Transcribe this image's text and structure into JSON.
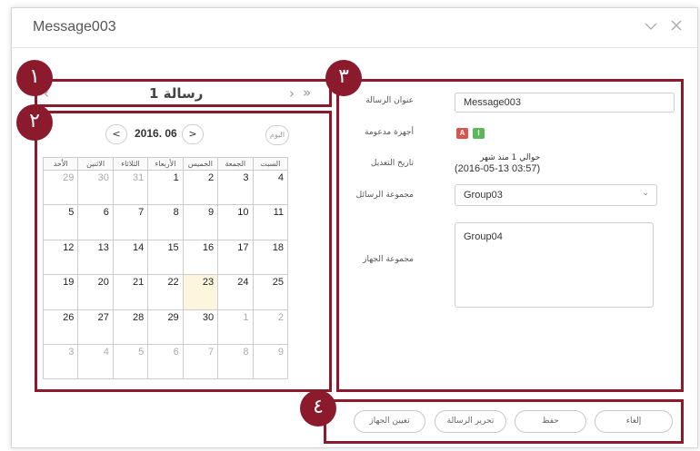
{
  "dialog": {
    "title": "Message003",
    "collapse_icon": "chevron-down-icon",
    "close_icon": "close-icon"
  },
  "annotations": {
    "badge1": "١",
    "badge2": "٢",
    "badge3": "٣",
    "badge4": "٤",
    "color": "#8b1a2d"
  },
  "section1": {
    "title": "رسالة 1",
    "prev_icon": "chevron-left-icon",
    "next_icon": "chevron-right-icon",
    "last_icon": "double-chevron-right-icon"
  },
  "calendar": {
    "month_label": "2016. 06",
    "prev_label": "<",
    "next_label": ">",
    "today_label": "اليوم",
    "weekdays": [
      "الأحد",
      "الاثنين",
      "الثلاثاء",
      "الأربعاء",
      "الخميس",
      "الجمعة",
      "السبت"
    ],
    "weeks": [
      [
        "29",
        "30",
        "31",
        "1",
        "2",
        "3",
        "4"
      ],
      [
        "5",
        "6",
        "7",
        "8",
        "9",
        "10",
        "11"
      ],
      [
        "12",
        "13",
        "14",
        "15",
        "16",
        "17",
        "18"
      ],
      [
        "19",
        "20",
        "21",
        "22",
        "23",
        "24",
        "25"
      ],
      [
        "26",
        "27",
        "28",
        "29",
        "30",
        "1",
        "2"
      ],
      [
        "3",
        "4",
        "5",
        "6",
        "7",
        "8",
        "9"
      ]
    ],
    "highlight_color": "#fbf6dd"
  },
  "form": {
    "title_label": "عنوان الرسالة",
    "title_value": "Message003",
    "devices_label": "أجهزة مدعومة",
    "device_a": "A",
    "device_i": "I",
    "device_a_color": "#d9534f",
    "device_i_color": "#5cb85c",
    "modified_label": "تاريخ التعديل",
    "modified_relative": "حوالي 1 منذ شهر",
    "modified_date": "(2016-05-13 03:57)",
    "group_label": "مجموعة الرسائل",
    "group_value": "Group03",
    "device_group_label": "مجموعة الجهاز",
    "device_group_value": "Group04"
  },
  "buttons": {
    "assign": "تعيين الجهاز",
    "edit": "تحرير الرسالة",
    "save": "حفظ",
    "cancel": "إلغاء"
  }
}
